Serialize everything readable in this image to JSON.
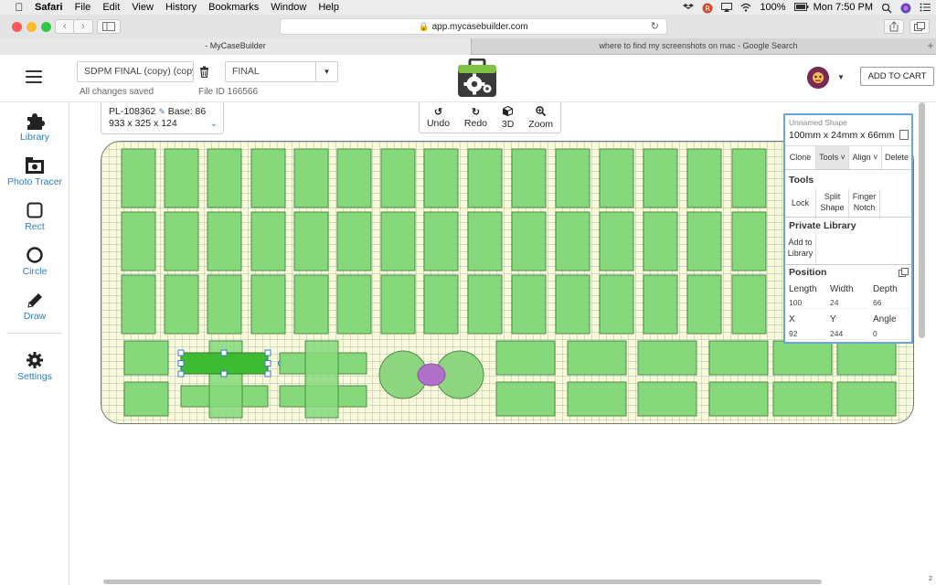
{
  "menubar": {
    "app": "Safari",
    "items": [
      "File",
      "Edit",
      "View",
      "History",
      "Bookmarks",
      "Window",
      "Help"
    ],
    "battery": "100%",
    "clock": "Mon 7:50 PM"
  },
  "browser": {
    "url": "app.mycasebuilder.com",
    "tabs": [
      "- MyCaseBuilder",
      "where to find my screenshots on mac - Google Search"
    ]
  },
  "header": {
    "project_name": "SDPM FINAL (copy) (copy)",
    "version": "FINAL",
    "save_status": "All changes saved",
    "file_id": "File ID 166566",
    "cart_label": "ADD TO CART"
  },
  "sidebar": {
    "items": [
      {
        "label": "Library",
        "icon": "puzzle-icon"
      },
      {
        "label": "Photo Tracer",
        "icon": "camera-icon"
      },
      {
        "label": "Rect",
        "icon": "rectangle-icon"
      },
      {
        "label": "Circle",
        "icon": "circle-icon"
      },
      {
        "label": "Draw",
        "icon": "pencil-icon"
      },
      {
        "label": "Settings",
        "icon": "gear-icon"
      }
    ]
  },
  "part": {
    "id": "PL-108362",
    "base": "Base: 86",
    "size": "933 x 325 x 124"
  },
  "view_tools": {
    "undo": "Undo",
    "redo": "Redo",
    "view3d": "3D",
    "zoom": "Zoom"
  },
  "properties": {
    "shape_name": "Unnamed Shape",
    "dimensions": "100mm x 24mm x 66mm",
    "actions": {
      "clone": "Clone",
      "tools": "Tools",
      "align": "Align",
      "delete": "Delete"
    },
    "tools_heading": "Tools",
    "tools": {
      "lock": "Lock",
      "split": "Split Shape",
      "finger": "Finger Notch"
    },
    "library_heading": "Private Library",
    "add_to_library": "Add to Library",
    "position_heading": "Position",
    "length_label": "Length",
    "length": "100",
    "width_label": "Width",
    "width": "24",
    "depth_label": "Depth",
    "depth": "66",
    "x_label": "X",
    "x": "92",
    "y_label": "Y",
    "y": "244",
    "angle_label": "Angle",
    "angle": "0"
  },
  "colors": {
    "accent": "#2a7ec9",
    "slot_fill": "#86d97a",
    "selected_fill": "#3fbb33",
    "board_fill": "#fbfbd9",
    "circle_fill": "#8ed57f",
    "finger_fill": "#b070c8"
  },
  "corner_label": "2"
}
